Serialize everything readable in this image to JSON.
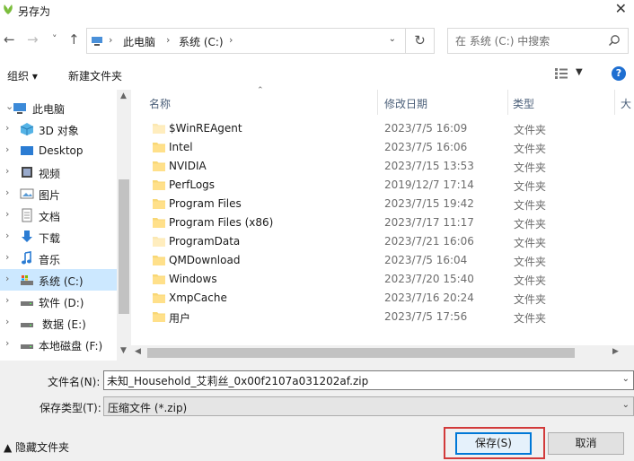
{
  "window": {
    "title": "另存为",
    "close_glyph": "✕"
  },
  "address": {
    "segments": [
      "此电脑",
      "系统 (C:)"
    ],
    "separator": "›",
    "dropdown_glyph": "⌄",
    "refresh_glyph": "↻"
  },
  "nav_buttons": {
    "back": "←",
    "forward": "→",
    "recent": "˅",
    "up": "↑"
  },
  "search": {
    "placeholder": "在 系统 (C:) 中搜索"
  },
  "toolbar": {
    "organize": "组织 ▾",
    "new_folder": "新建文件夹",
    "view_dropdown": "▼",
    "help": "?"
  },
  "sidebar": {
    "items": [
      {
        "label": "此电脑",
        "icon": "computer-icon",
        "chevron": "⌄",
        "selected": false
      },
      {
        "label": "3D 对象",
        "icon": "3d-objects-icon",
        "chevron": "›",
        "selected": false
      },
      {
        "label": "Desktop",
        "icon": "desktop-icon",
        "chevron": "›",
        "selected": false
      },
      {
        "label": "视频",
        "icon": "video-icon",
        "chevron": "›",
        "selected": false
      },
      {
        "label": "图片",
        "icon": "pictures-icon",
        "chevron": "›",
        "selected": false
      },
      {
        "label": "文档",
        "icon": "documents-icon",
        "chevron": "›",
        "selected": false
      },
      {
        "label": "下载",
        "icon": "downloads-icon",
        "chevron": "›",
        "selected": false
      },
      {
        "label": "音乐",
        "icon": "music-icon",
        "chevron": "›",
        "selected": false
      },
      {
        "label": "系统 (C:)",
        "icon": "system-drive-icon",
        "chevron": "›",
        "selected": true
      },
      {
        "label": "软件 (D:)",
        "icon": "drive-icon",
        "chevron": "›",
        "selected": false
      },
      {
        "label": "数据 (E:)",
        "icon": "drive-icon",
        "chevron": "›",
        "selected": false
      },
      {
        "label": "本地磁盘 (F:)",
        "icon": "drive-icon",
        "chevron": "›",
        "selected": false
      }
    ]
  },
  "columns": {
    "name": "名称",
    "modified": "修改日期",
    "type": "类型",
    "size": "大"
  },
  "files": [
    {
      "name": "$WinREAgent",
      "modified": "2023/7/5 16:09",
      "type": "文件夹",
      "hidden": true
    },
    {
      "name": "Intel",
      "modified": "2023/7/5 16:06",
      "type": "文件夹",
      "hidden": false
    },
    {
      "name": "NVIDIA",
      "modified": "2023/7/15 13:53",
      "type": "文件夹",
      "hidden": false
    },
    {
      "name": "PerfLogs",
      "modified": "2019/12/7 17:14",
      "type": "文件夹",
      "hidden": false
    },
    {
      "name": "Program Files",
      "modified": "2023/7/15 19:42",
      "type": "文件夹",
      "hidden": false
    },
    {
      "name": "Program Files (x86)",
      "modified": "2023/7/17 11:17",
      "type": "文件夹",
      "hidden": false
    },
    {
      "name": "ProgramData",
      "modified": "2023/7/21 16:06",
      "type": "文件夹",
      "hidden": true
    },
    {
      "name": "QMDownload",
      "modified": "2023/7/5 16:04",
      "type": "文件夹",
      "hidden": false
    },
    {
      "name": "Windows",
      "modified": "2023/7/20 15:40",
      "type": "文件夹",
      "hidden": false
    },
    {
      "name": "XmpCache",
      "modified": "2023/7/16 20:24",
      "type": "文件夹",
      "hidden": false
    },
    {
      "name": "用户",
      "modified": "2023/7/5 17:56",
      "type": "文件夹",
      "hidden": false
    }
  ],
  "form": {
    "filename_label": "文件名(N):",
    "filename_value": "未知_Household_艾莉丝_0x00f2107a031202af.zip",
    "filetype_label": "保存类型(T):",
    "filetype_value": "压缩文件 (*.zip)",
    "dropdown_glyph": "⌄"
  },
  "footer": {
    "hide_folders": "▲ 隐藏文件夹",
    "save_label": "保存(S)",
    "cancel_label": "取消"
  },
  "colors": {
    "accent": "#0078d7",
    "selection": "#cce8ff",
    "folder": "#f8d775",
    "highlight_box": "#d23a3a"
  }
}
